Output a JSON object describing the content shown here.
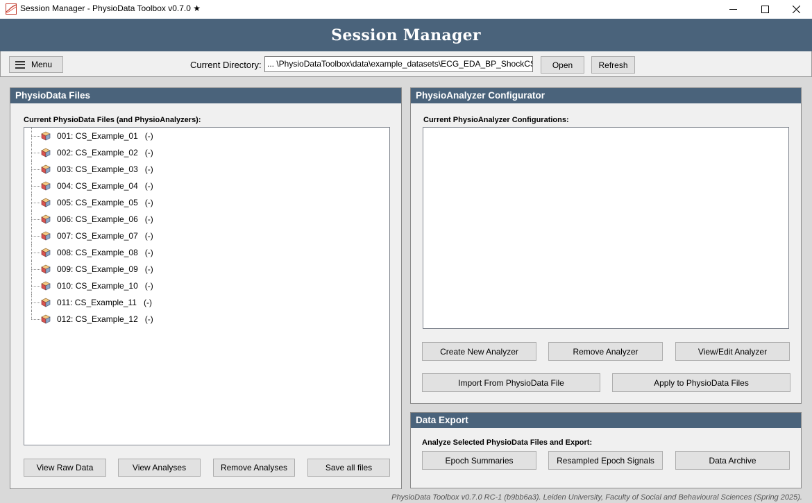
{
  "window": {
    "title": "Session Manager - PhysioData Toolbox v0.7.0 ★",
    "app_icon": "physiodata-app-icon",
    "controls": [
      "minimize-icon",
      "maximize-icon",
      "close-icon"
    ]
  },
  "banner": {
    "title": "Session Manager"
  },
  "toolbar": {
    "menu_label": "Menu",
    "directory_label": "Current Directory:",
    "directory_value": "... \\PhysioDataToolbox\\data\\example_datasets\\ECG_EDA_BP_ShockCS\\",
    "open_label": "Open",
    "refresh_label": "Refresh"
  },
  "files_panel": {
    "header": "PhysioData Files",
    "list_label": "Current PhysioData Files (and PhysioAnalyzers):",
    "items": [
      "001: CS_Example_01   (-)",
      "002: CS_Example_02   (-)",
      "003: CS_Example_03   (-)",
      "004: CS_Example_04   (-)",
      "005: CS_Example_05   (-)",
      "006: CS_Example_06   (-)",
      "007: CS_Example_07   (-)",
      "008: CS_Example_08   (-)",
      "009: CS_Example_09   (-)",
      "010: CS_Example_10   (-)",
      "011: CS_Example_11   (-)",
      "012: CS_Example_12   (-)"
    ],
    "buttons": {
      "view_raw": "View Raw Data",
      "view_analyses": "View Analyses",
      "remove_analyses": "Remove Analyses",
      "save_all": "Save all files"
    }
  },
  "analyzer_panel": {
    "header": "PhysioAnalyzer Configurator",
    "list_label": "Current PhysioAnalyzer Configurations:",
    "buttons": {
      "create": "Create New Analyzer",
      "remove": "Remove Analyzer",
      "view_edit": "View/Edit Analyzer",
      "import": "Import From PhysioData File",
      "apply": "Apply to PhysioData Files"
    }
  },
  "export_panel": {
    "header": "Data Export",
    "label": "Analyze Selected PhysioData Files and Export:",
    "buttons": {
      "epoch_summaries": "Epoch Summaries",
      "resampled": "Resampled Epoch Signals",
      "archive": "Data Archive"
    }
  },
  "footer": "PhysioData Toolbox v0.7.0 RC-1 (b9bb6a3). Leiden University, Faculty of Social and Behavioural Sciences (Spring 2025).",
  "colors": {
    "header_bg": "#4a637b",
    "panel_bg": "#f0f0f0",
    "window_bg": "#d9d9d9"
  }
}
